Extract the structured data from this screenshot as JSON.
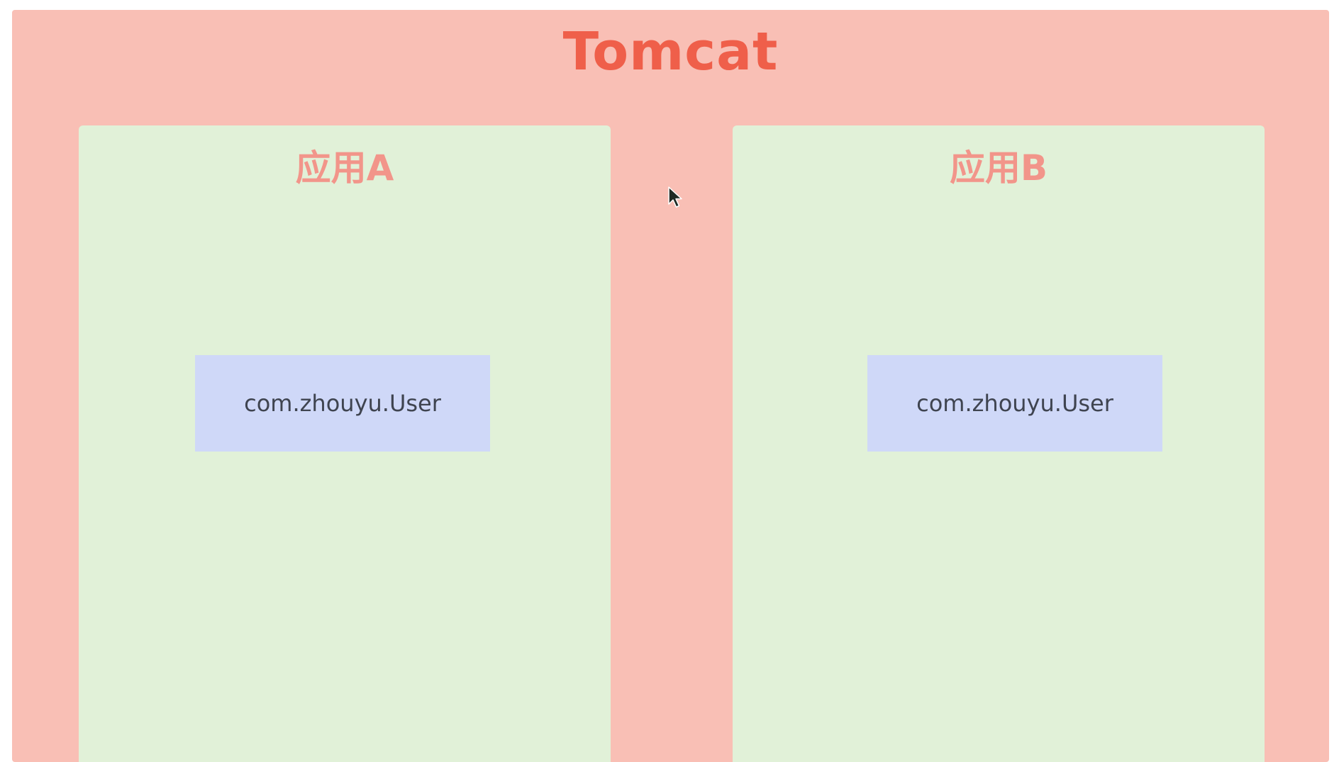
{
  "diagram": {
    "container_title": "Tomcat",
    "apps": [
      {
        "title": "应用A",
        "class_name": "com.zhouyu.User"
      },
      {
        "title": "应用B",
        "class_name": "com.zhouyu.User"
      }
    ]
  },
  "colors": {
    "container_bg": "#f9bfb5",
    "container_title": "#ef5f4a",
    "app_bg": "#e1f1d8",
    "app_title": "#f2958a",
    "class_box_bg": "#cfd8f8",
    "class_box_text": "#3f4450"
  },
  "icons": {
    "cursor": "mouse-pointer-icon"
  }
}
